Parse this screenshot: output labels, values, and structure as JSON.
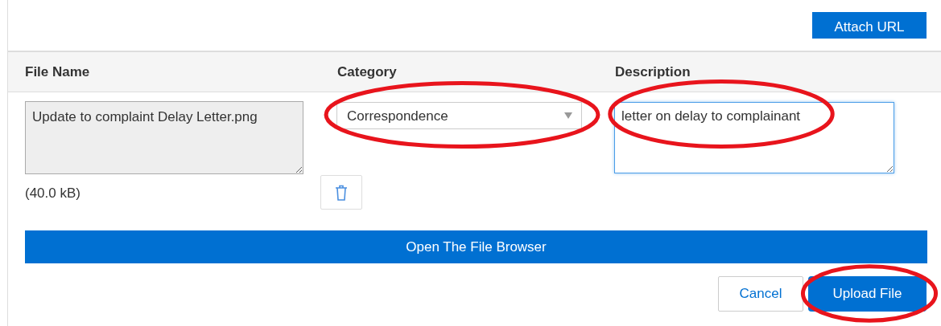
{
  "attach_button": {
    "label": "Attach URL"
  },
  "columns": [
    "File Name",
    "Category",
    "Description"
  ],
  "file": {
    "name": "Update to complaint Delay Letter.png",
    "size": "(40.0 kB)"
  },
  "category": {
    "value": "Correspondence",
    "circled": true
  },
  "description": {
    "value": "letter on delay to complainant",
    "circled": true,
    "focused": true
  },
  "browse_button": {
    "label": "Open The File Browser"
  },
  "cancel_button": {
    "label": "Cancel"
  },
  "upload_button": {
    "label": "Upload File",
    "circled": true
  }
}
